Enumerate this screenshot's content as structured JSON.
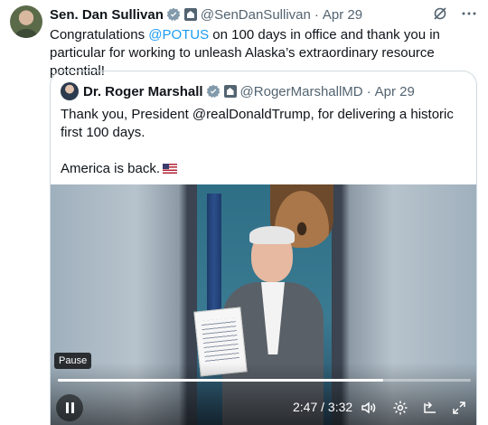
{
  "tweet": {
    "author_name": "Sen. Dan Sullivan",
    "author_handle": "@SenDanSullivan",
    "separator": "·",
    "date": "Apr 29",
    "text_before": "Congratulations ",
    "mention": "@POTUS",
    "text_after": " on 100 days in office and thank you in particular for working to unleash Alaska’s extraordinary resource potential!",
    "icons": [
      "verified-badge-icon",
      "government-label-icon",
      "grok-icon",
      "more-icon"
    ],
    "colors": {
      "accent": "#1d9bf0",
      "muted": "#536471",
      "text": "#0f1419",
      "border": "#cfd9de"
    }
  },
  "quoted_tweet": {
    "author_name": "Dr. Roger Marshall",
    "author_handle": "@RogerMarshallMD",
    "separator": "·",
    "date": "Apr 29",
    "text_line1": "Thank you, President @realDonaldTrump, for delivering a historic first 100 days.",
    "text_line2": "America is back.",
    "emoji": "us-flag-icon"
  },
  "video": {
    "tooltip": "Pause",
    "current_time": "2:47",
    "duration": "3:32",
    "time_display": "2:47 / 3:32",
    "progress": 0.788,
    "controls": [
      "pause-icon",
      "volume-icon",
      "settings-icon",
      "pip-icon",
      "fullscreen-icon"
    ]
  }
}
